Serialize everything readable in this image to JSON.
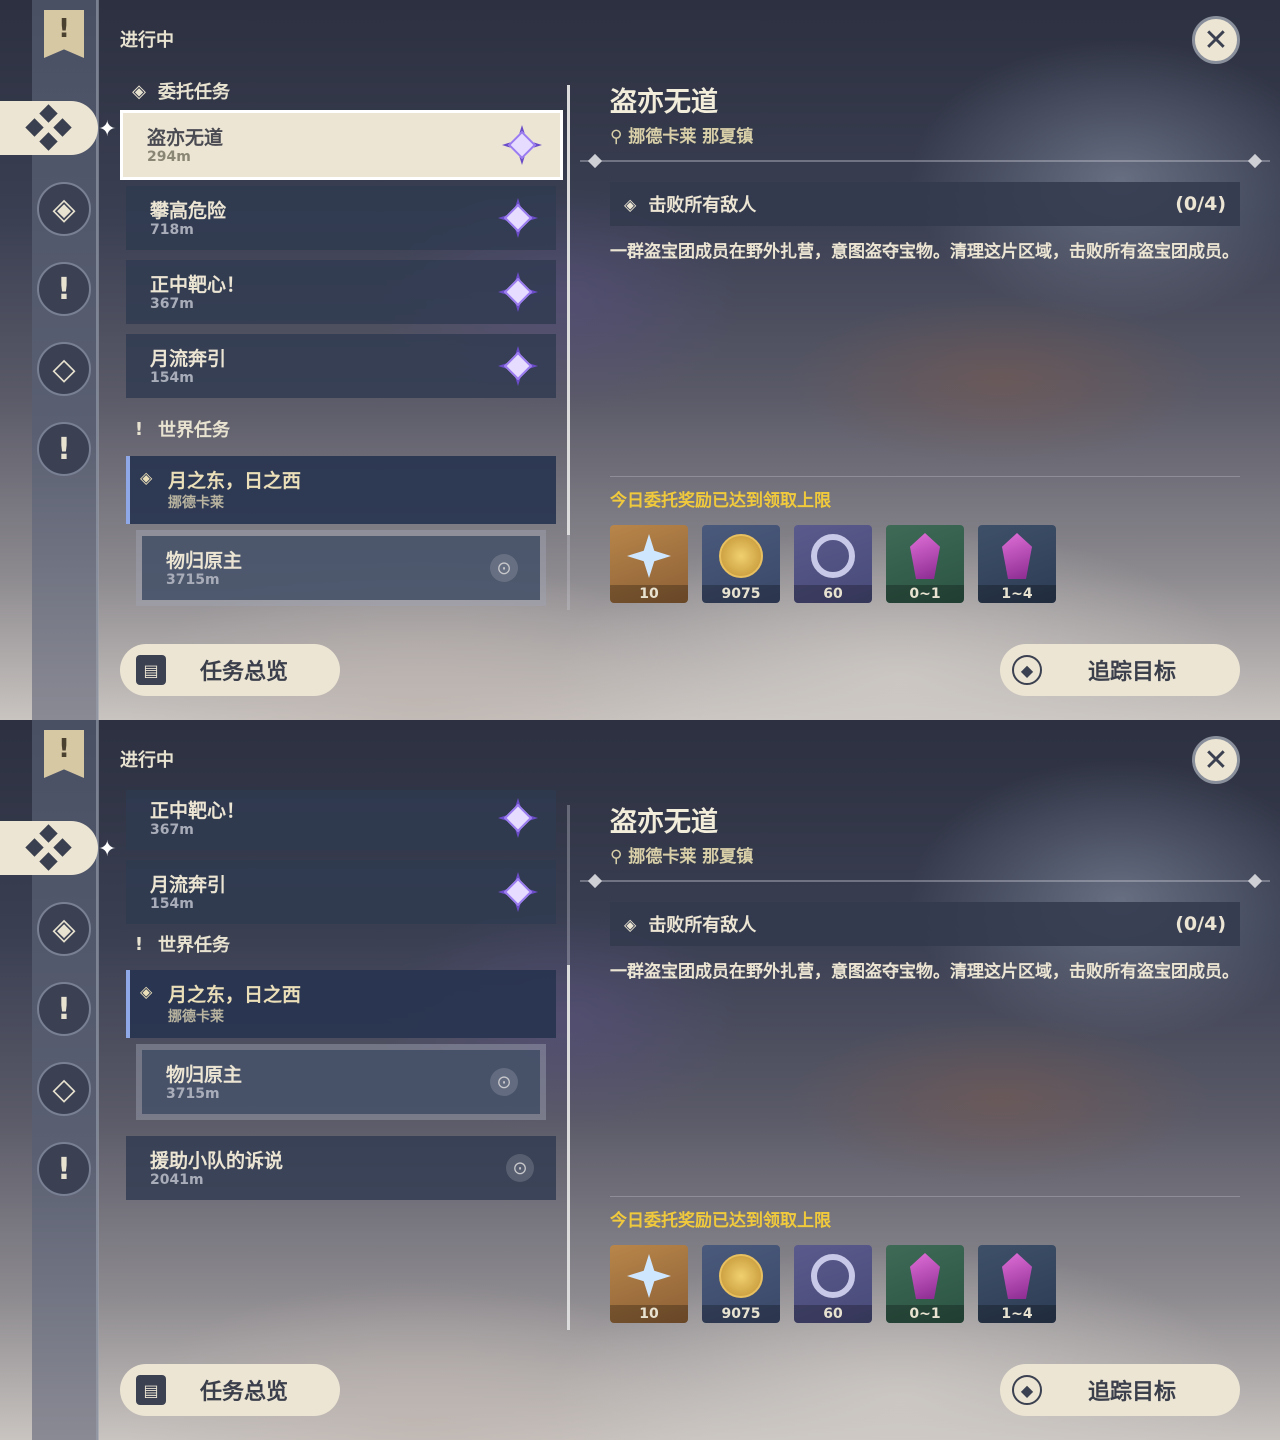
{
  "section_title": "进行中",
  "close_icon": "✕",
  "screens": [
    {
      "list": {
        "categories": [
          {
            "label": "委托任务",
            "icon": "diamond-outline-icon"
          },
          {
            "label": "世界任务",
            "icon": "exclamation-icon"
          }
        ],
        "items": [
          {
            "name": "盗亦无道",
            "dist": "294m"
          },
          {
            "name": "攀高危险",
            "dist": "718m"
          },
          {
            "name": "正中靶心！",
            "dist": "367m"
          },
          {
            "name": "月流奔引",
            "dist": "154m"
          },
          {
            "name": "月之东，日之西",
            "dist": "挪德卡莱"
          },
          {
            "name": "物归原主",
            "dist": "3715m"
          }
        ]
      }
    },
    {
      "list": {
        "categories": [
          {
            "label": "世界任务",
            "icon": "exclamation-icon"
          }
        ],
        "items": [
          {
            "name": "正中靶心！",
            "dist": "367m"
          },
          {
            "name": "月流奔引",
            "dist": "154m"
          },
          {
            "name": "月之东，日之西",
            "dist": "挪德卡莱"
          },
          {
            "name": "物归原主",
            "dist": "3715m"
          },
          {
            "name": "援助小队的诉说",
            "dist": "2041m"
          }
        ]
      }
    }
  ],
  "detail": {
    "title": "盗亦无道",
    "location": "挪德卡莱 那夏镇",
    "objective": "击败所有敌人",
    "progress": "(0/4)",
    "description": "一群盗宝团成员在野外扎营，意图盗夺宝物。清理这片区域，击败所有盗宝团成员。",
    "reward_note": "今日委托奖励已达到领取上限",
    "rewards": [
      {
        "icon": "primogem-icon",
        "count": "10"
      },
      {
        "icon": "mora-icon",
        "count": "9075"
      },
      {
        "icon": "friendship-icon",
        "count": "60"
      },
      {
        "icon": "crystal-icon",
        "count": "0~1"
      },
      {
        "icon": "crystal-cluster-icon",
        "count": "1~4"
      }
    ]
  },
  "buttons": {
    "overview": "任务总览",
    "track": "追踪目标"
  }
}
